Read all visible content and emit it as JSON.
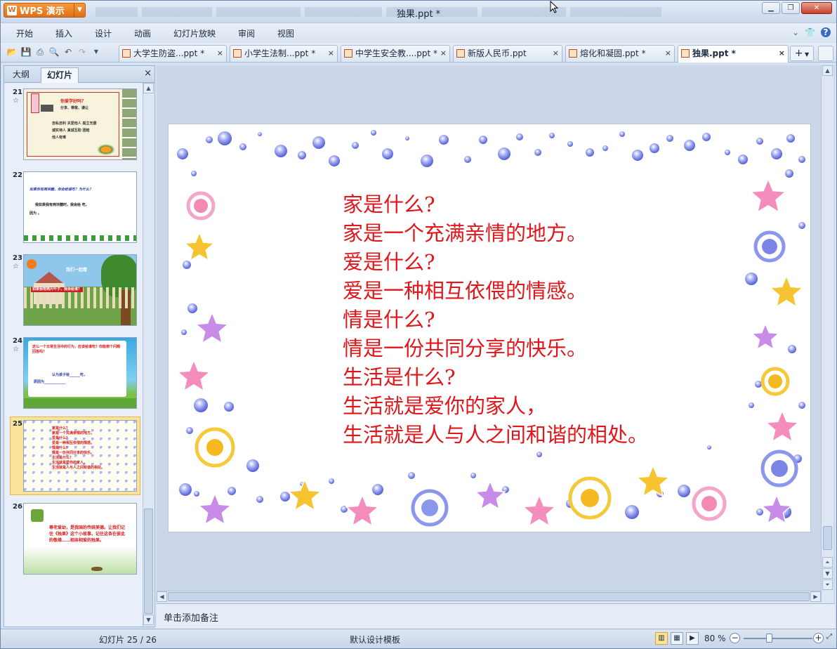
{
  "app": {
    "button_label": "WPS 演示",
    "window_title": "独果.ppt *"
  },
  "menu": [
    "开始",
    "插入",
    "设计",
    "动画",
    "幻灯片放映",
    "审阅",
    "视图"
  ],
  "menu_right": {
    "collapse": "⌄",
    "skin": "👕",
    "help": "?"
  },
  "tabs": [
    {
      "label": "大学生防盗...ppt *",
      "close": "×"
    },
    {
      "label": "小学生法制...ppt *",
      "close": "×"
    },
    {
      "label": "中学生安全教....ppt *",
      "close": "×"
    },
    {
      "label": "新版人民币.ppt",
      "close": "×"
    },
    {
      "label": "熔化和凝固.ppt *",
      "close": "×"
    },
    {
      "label": "独果.ppt *",
      "close": "×"
    }
  ],
  "tab_add": "+",
  "pane": {
    "tab_outline": "大纲",
    "tab_slides": "幻灯片",
    "close": "×"
  },
  "thumbnails": [
    {
      "num": "21",
      "star": "☆",
      "l1": "你爱学好吗？",
      "l2": "分享、尊敬、谦让",
      "l3": "自私自利   关爱他人   孤立无援",
      "l4": "诚实待人   真诚互助   团结",
      "l5": "他人有难"
    },
    {
      "num": "22",
      "star": "",
      "l1": "如果你有两块糖，你会给谁吃？为什么？",
      "l2": "我如果我有两块糖时，我会给              吃，",
      "l3": "因为                                。"
    },
    {
      "num": "23",
      "star": "☆",
      "l1": "我们一起看",
      "l2": "如果我有两片叶子，我会给谁？"
    },
    {
      "num": "24",
      "star": "☆",
      "l1": "这么一个日常生活中的行为，应该给谁吃？你能想个问题回答吗？",
      "l2": "认为孩子给______吃，",
      "l3": "原因为____________"
    },
    {
      "num": "25",
      "star": "",
      "lines": [
        "家是什么？",
        "家是一个充满亲情的地方。",
        "爱是什么？",
        "爱是一种相互依偎的情感。",
        "情是什么？",
        "情是一份共同分享的快乐。",
        "生活是什么？",
        "生活就是爱你的家人，",
        "生活就是人与人之间和谐的相处。"
      ]
    },
    {
      "num": "26",
      "star": "",
      "l1": "尊老爱幼，是我国的传统美德。让我们记住《独果》这个小故事，记住这条在彼此的敬缘……相亲相爱的独果。"
    }
  ],
  "slide": {
    "lines": [
      "家是什么?",
      "家是一个充满亲情的地方。",
      "爱是什么?",
      "爱是一种相互依偎的情感。",
      "情是什么?",
      "情是一份共同分享的快乐。",
      "生活是什么?",
      "生活就是爱你的家人，",
      "生活就是人与人之间和谐的相处。"
    ]
  },
  "notes_placeholder": "单击添加备注",
  "status": {
    "slide": "幻灯片 25 / 26",
    "template": "默认设计模板",
    "zoom": "80 %",
    "zoom_level": 0.8
  },
  "colors": {
    "slide_text": "#e0161b",
    "accent": "#e0701a",
    "selection": "#fbe39b"
  }
}
